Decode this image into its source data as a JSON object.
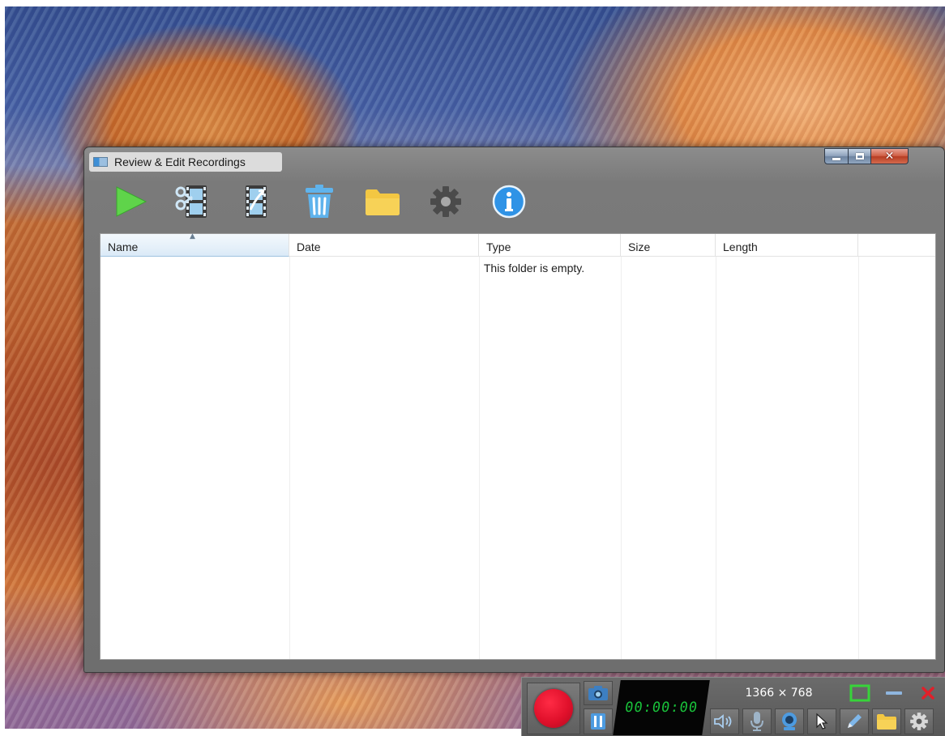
{
  "window": {
    "title": "Review & Edit Recordings",
    "controls": {
      "minimize": "minimize",
      "maximize": "maximize",
      "close": "close"
    }
  },
  "toolbar": {
    "items": [
      {
        "id": "play",
        "icon": "play-icon"
      },
      {
        "id": "trim",
        "icon": "film-scissors-icon"
      },
      {
        "id": "upload",
        "icon": "film-share-icon"
      },
      {
        "id": "delete",
        "icon": "trash-icon"
      },
      {
        "id": "folder",
        "icon": "folder-icon"
      },
      {
        "id": "settings",
        "icon": "gear-icon"
      },
      {
        "id": "info",
        "icon": "info-icon"
      }
    ]
  },
  "list": {
    "columns": [
      "Name",
      "Date",
      "Type",
      "Size",
      "Length"
    ],
    "sorted_column": "Name",
    "empty_message": "This folder is empty."
  },
  "recorder": {
    "timer": "00:00:00",
    "resolution": "1366 × 768",
    "colors": {
      "record": "#e0102b",
      "timer_text": "#19c13a",
      "window_frame": "#6e6e6e",
      "close_x": "#e0202a",
      "folder": "#f3c742"
    }
  }
}
